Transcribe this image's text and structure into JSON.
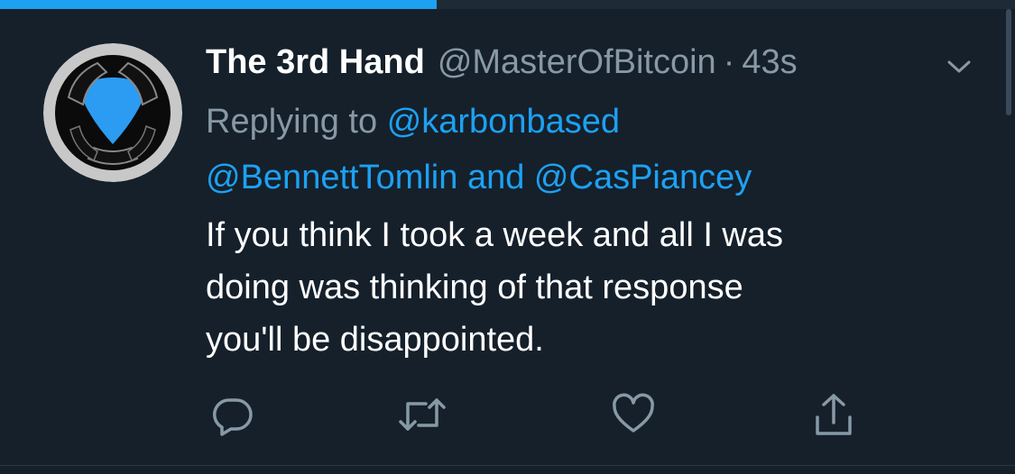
{
  "progress": {
    "fraction": 0.43,
    "color": "#1da1f2"
  },
  "tweet": {
    "display_name": "The 3rd Hand",
    "handle": "@MasterOfBitcoin",
    "separator": "·",
    "timestamp": "43s",
    "replying_prefix": "Replying to",
    "mentions": [
      "@karbonbased",
      "@BennettTomlin",
      "@CasPiancey"
    ],
    "mention_joiner": "and",
    "text_lines": [
      "If you think I took a week and all I was",
      "doing was thinking of that response",
      "you'll be disappointed."
    ]
  },
  "actions": [
    {
      "name": "reply",
      "icon": "speech-bubble"
    },
    {
      "name": "retweet",
      "icon": "retweet-arrows"
    },
    {
      "name": "like",
      "icon": "heart"
    },
    {
      "name": "share",
      "icon": "upload-arrow"
    }
  ],
  "colors": {
    "background": "#15202b",
    "accent": "#1da1f2",
    "secondary_text": "#8899a6",
    "primary_text": "#ffffff"
  }
}
